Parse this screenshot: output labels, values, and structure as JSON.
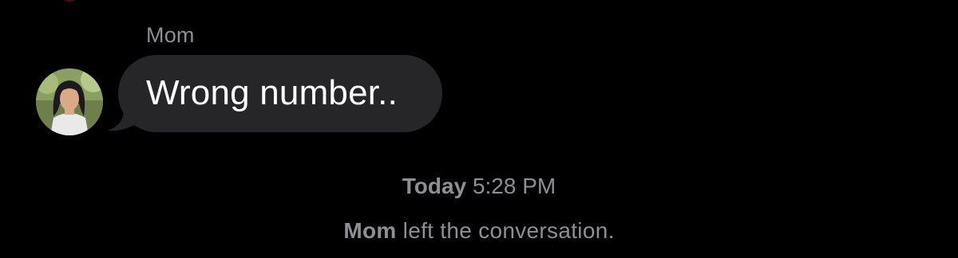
{
  "conversation": {
    "sender_name": "Mom",
    "message": {
      "text": "Wrong number..",
      "bubble_color": "#262628",
      "text_color": "#ffffff"
    },
    "timestamp": {
      "day": "Today",
      "time": "5:28 PM"
    },
    "system_note": {
      "who": "Mom",
      "action": "left the conversation."
    },
    "avatar": {
      "icon": "contact-photo"
    }
  },
  "theme": {
    "background": "#000000",
    "secondary_text": "#8e8e93"
  }
}
